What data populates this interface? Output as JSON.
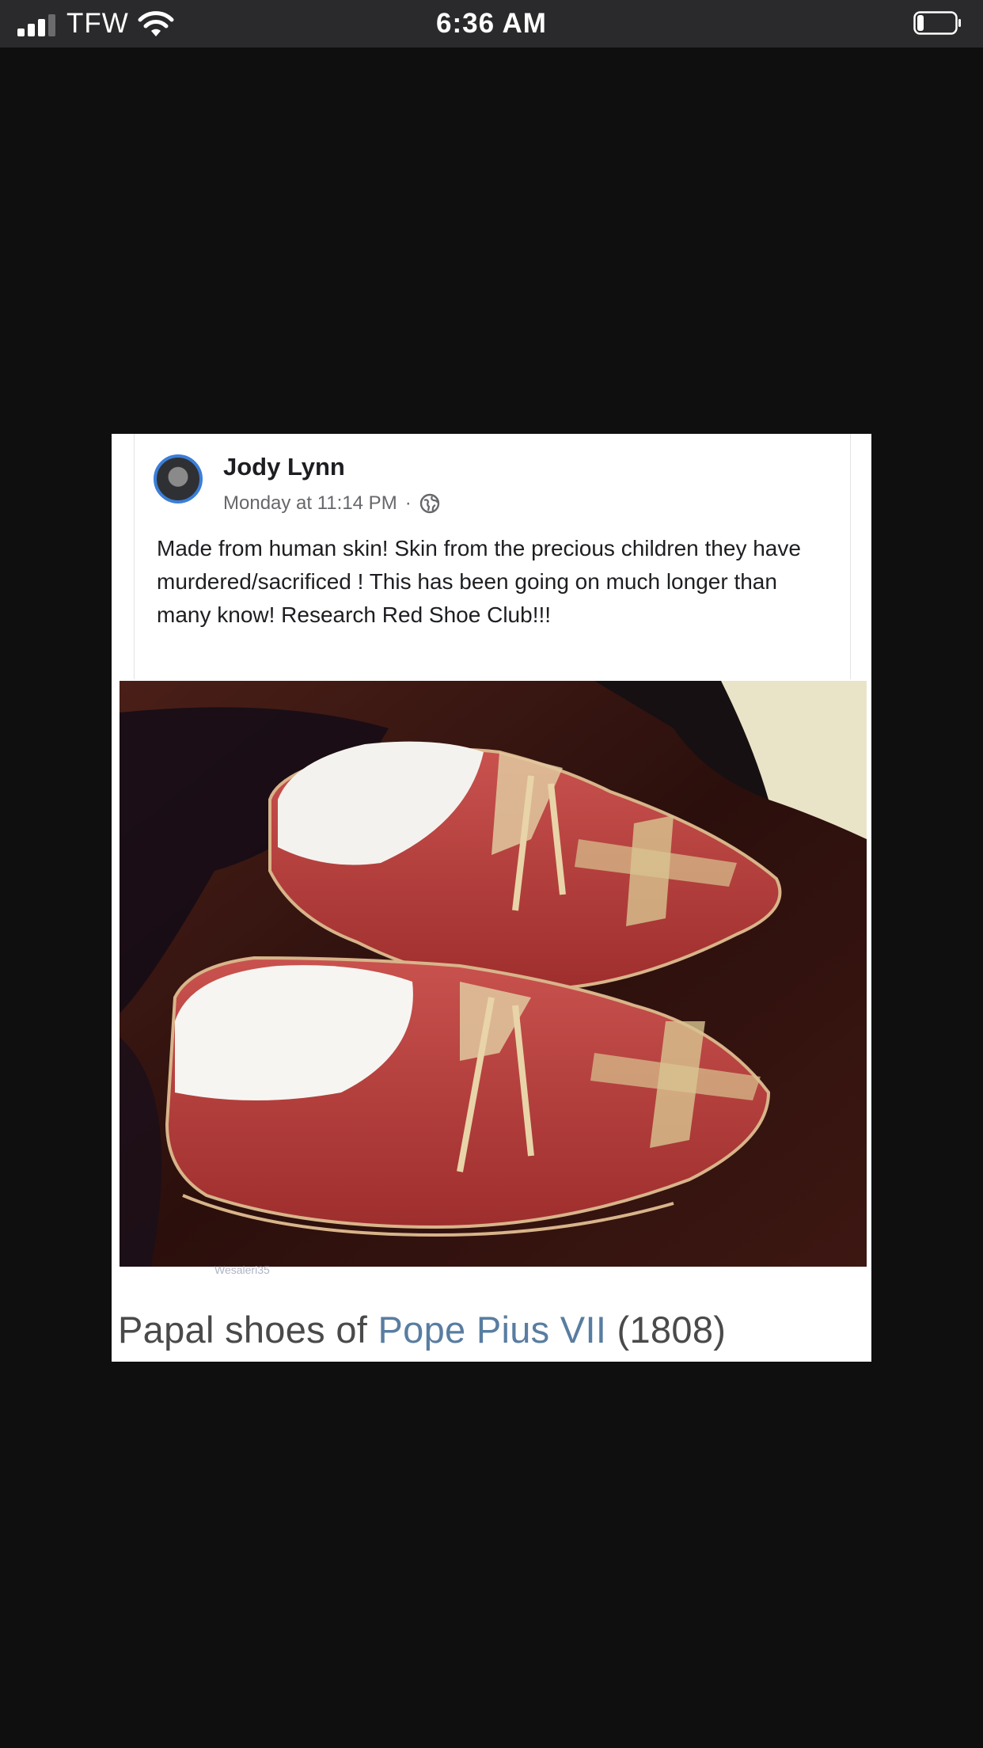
{
  "status_bar": {
    "carrier": "TFW",
    "time": "6:36 AM",
    "signal_bars": 3,
    "battery_level": 0.12
  },
  "post": {
    "author": "Jody Lynn",
    "timestamp": "Monday at 11:14 PM",
    "separator": "·",
    "audience_icon": "globe-icon",
    "text": "Made from human skin! Skin from the precious children they have murdered/sacrificed ! This has been going on much longer than many know! Research Red Shoe Club!!!",
    "photo_description_icon": "red-shoes-photo",
    "watermark": "Wesaleri35"
  },
  "caption": {
    "prefix": "Papal shoes of ",
    "link": "Pope Pius VII",
    "suffix": " (1808)"
  },
  "colors": {
    "link": "#597da1",
    "avatar_ring": "#3b7ed8",
    "shoe_red": "#b8403c"
  }
}
